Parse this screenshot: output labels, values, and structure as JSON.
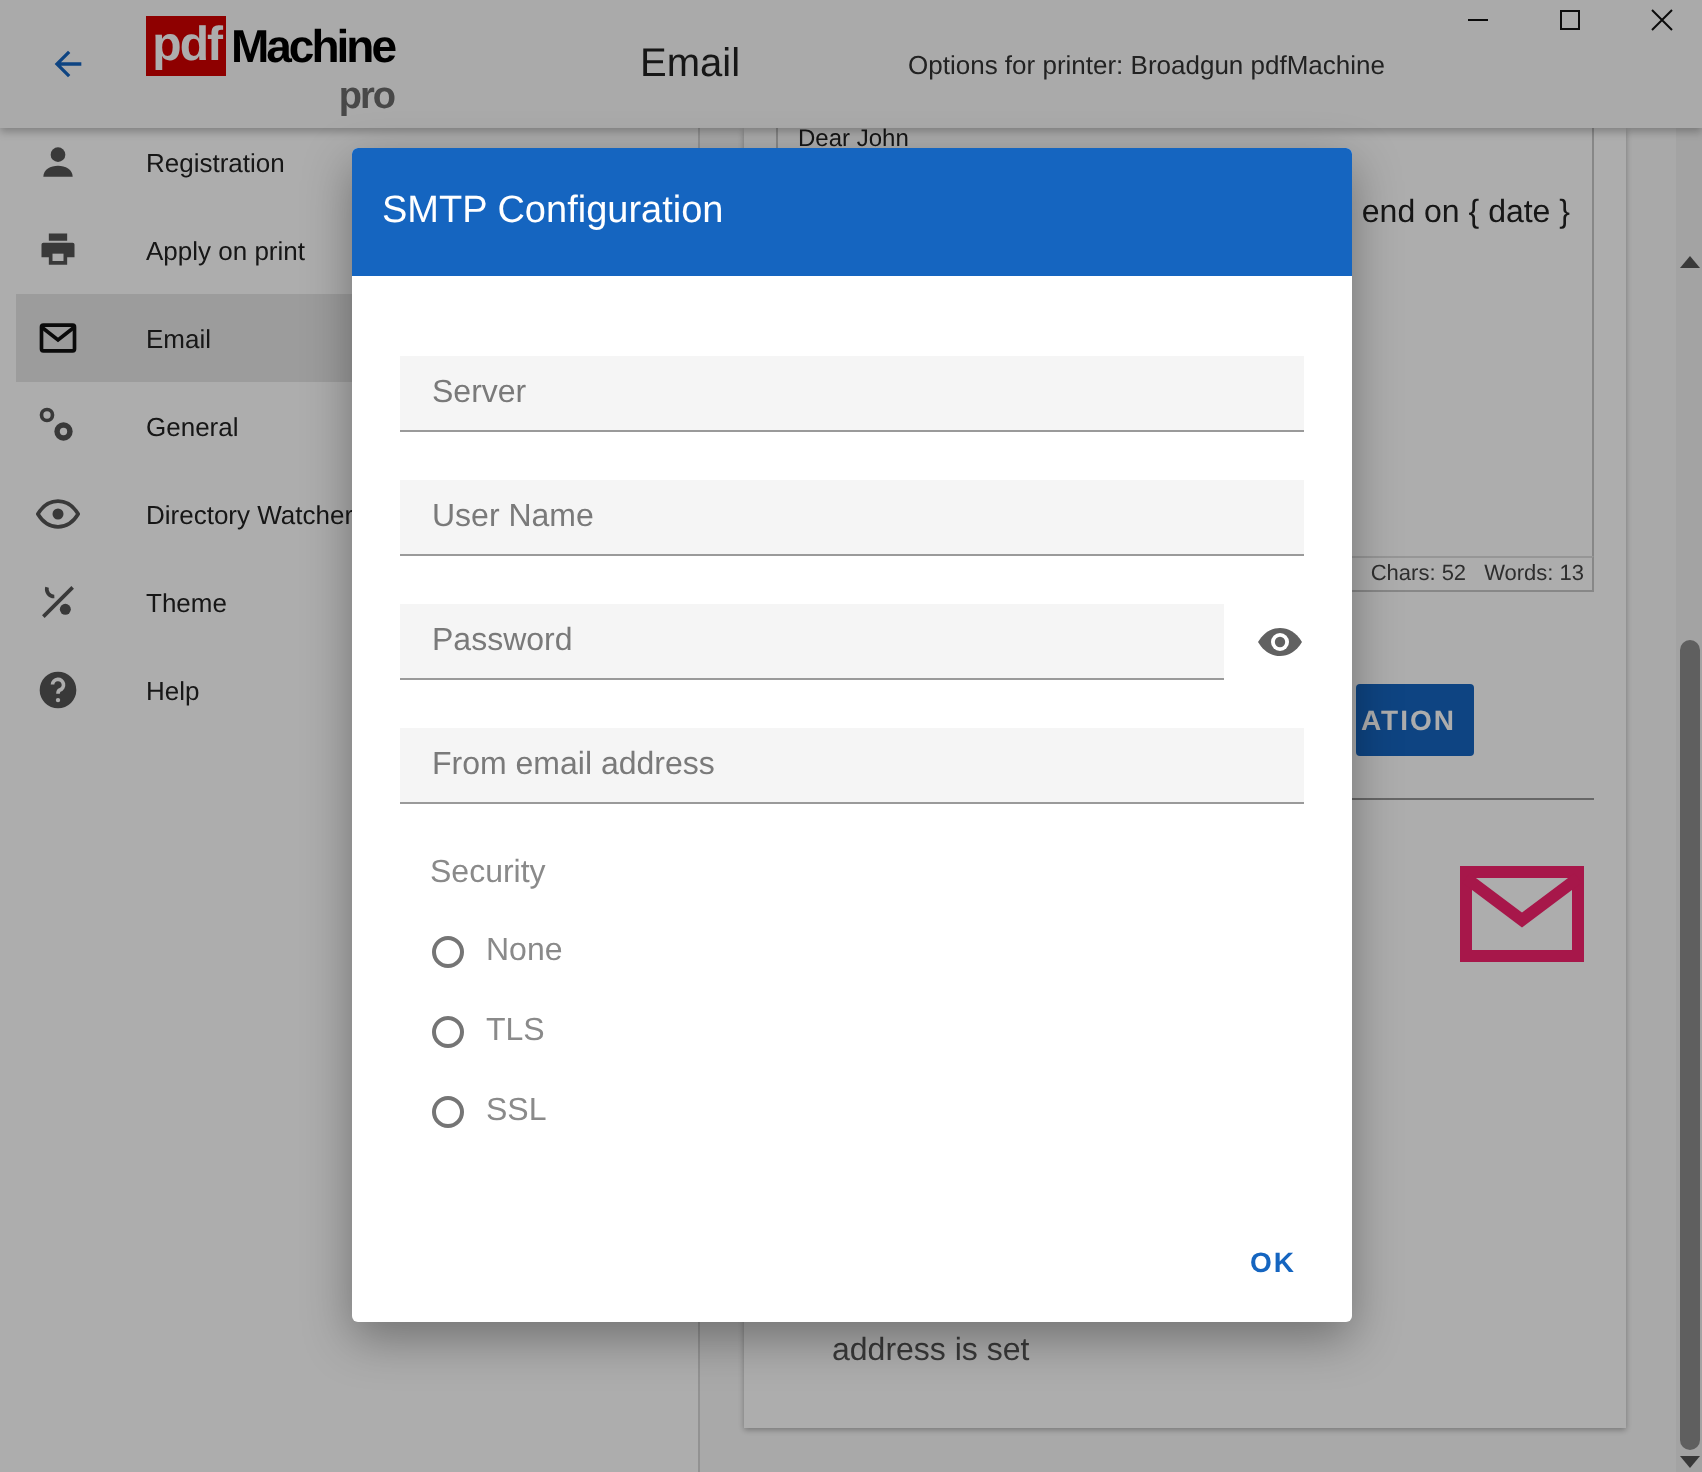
{
  "header": {
    "logo": {
      "brand": "pdf",
      "name": "Machine",
      "edition": "pro"
    },
    "title": "Email",
    "subtitle": "Options for printer: Broadgun pdfMachine"
  },
  "sidebar": {
    "items": [
      {
        "label": "Registration",
        "selected": false
      },
      {
        "label": "Apply on print",
        "selected": false
      },
      {
        "label": "Email",
        "selected": true
      },
      {
        "label": "General",
        "selected": false
      },
      {
        "label": "Directory Watcher",
        "selected": false
      },
      {
        "label": "Theme",
        "selected": false
      },
      {
        "label": "Help",
        "selected": false
      }
    ]
  },
  "content": {
    "editor": {
      "lines": [
        "Dear John",
        "end on { date }"
      ],
      "chars": "Chars: 52",
      "words": "Words: 13"
    },
    "button": "ATION",
    "note": "address is set"
  },
  "dialog": {
    "title": "SMTP Configuration",
    "fields": [
      {
        "placeholder": "Server",
        "kind": "text"
      },
      {
        "placeholder": "User Name",
        "kind": "text"
      },
      {
        "placeholder": "Password",
        "kind": "password"
      },
      {
        "placeholder": "From email address",
        "kind": "text"
      }
    ],
    "security": {
      "label": "Security",
      "options": [
        {
          "label": "None",
          "selected": false
        },
        {
          "label": "TLS",
          "selected": false
        },
        {
          "label": "SSL",
          "selected": false
        }
      ]
    },
    "ok": "OK"
  }
}
